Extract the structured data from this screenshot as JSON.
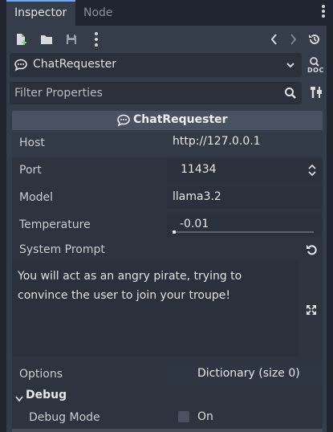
{
  "tabs": [
    {
      "label": "Inspector",
      "active": true
    },
    {
      "label": "Node",
      "active": false
    }
  ],
  "object_selector": {
    "name": "ChatRequester"
  },
  "filter": {
    "placeholder": "Filter Properties"
  },
  "section": {
    "title": "ChatRequester"
  },
  "properties": {
    "host": {
      "label": "Host",
      "value": "http://127.0.0.1"
    },
    "port": {
      "label": "Port",
      "value": "11434"
    },
    "model": {
      "label": "Model",
      "value": "llama3.2"
    },
    "temperature": {
      "label": "Temperature",
      "value": "-0.01"
    },
    "system_prompt": {
      "label": "System Prompt",
      "value": "You will act as an angry pirate, trying to convince the user to join your troupe!"
    },
    "options": {
      "label": "Options",
      "value": "Dictionary (size 0)"
    }
  },
  "debug_group": {
    "title": "Debug",
    "expanded": true
  },
  "debug_mode": {
    "label": "Debug Mode",
    "toggle_label": "On",
    "checked": false
  },
  "doc_icon_text": "DOC",
  "colors": {
    "accent": "#6fa7f7",
    "panel": "#363d4a",
    "field": "#2a303c"
  }
}
